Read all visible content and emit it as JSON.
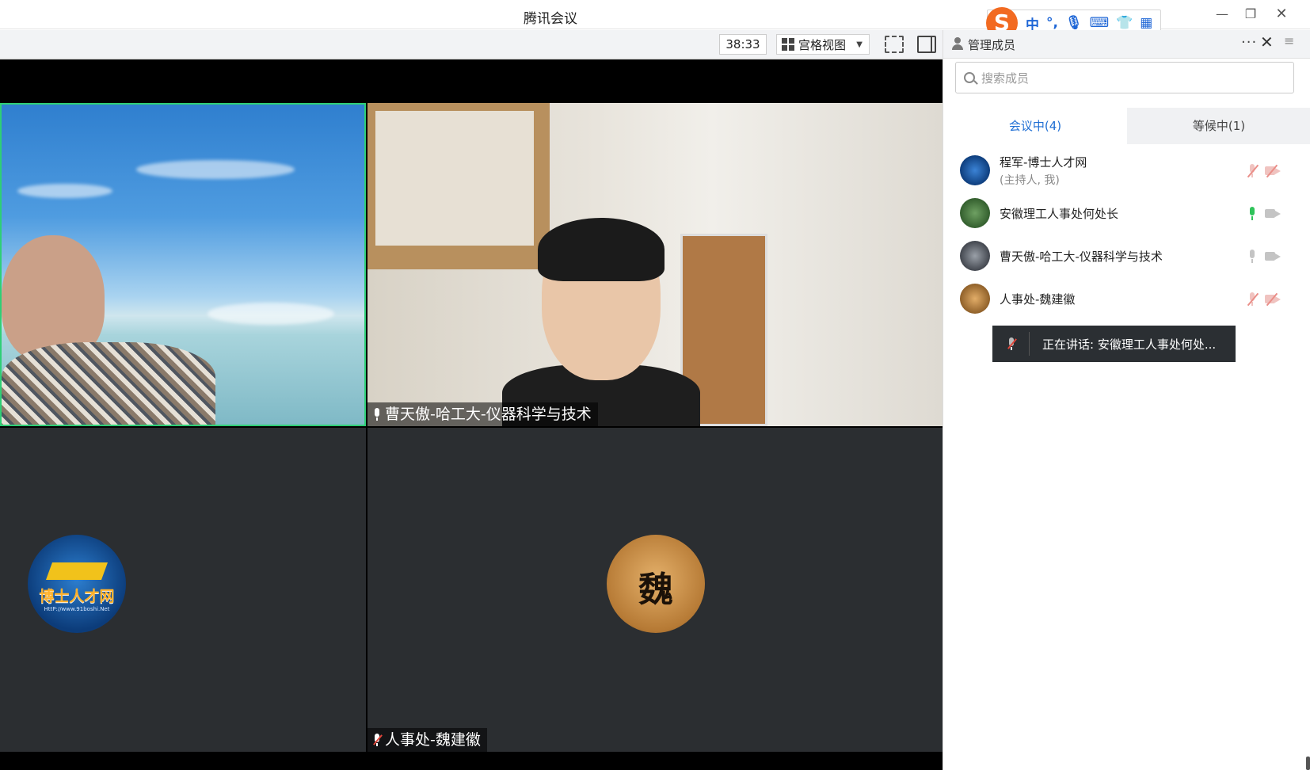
{
  "window": {
    "title": "腾讯会议",
    "minimize_icon": "minimize-icon",
    "restore_icon": "restore-icon",
    "close_icon": "close-icon"
  },
  "ime": {
    "logo": "S",
    "items": [
      "中",
      "°,",
      "mic-icon",
      "keyboard-icon",
      "shirt-icon",
      "apps-icon"
    ]
  },
  "toolbar": {
    "timer": "38:33",
    "view_label": "宫格视图"
  },
  "tiles": [
    {
      "name": "",
      "kind": "video",
      "active_speaker": true
    },
    {
      "name": "曹天傲-哈工大-仪器科学与技术",
      "kind": "video",
      "mic": "on"
    },
    {
      "name": "",
      "kind": "avatar",
      "avatar_text": "博士人才网",
      "avatar_sub": "HttP://www.91boshi.Net"
    },
    {
      "name": "人事处-魏建徽",
      "kind": "avatar",
      "avatar_text": "魏",
      "mic": "muted"
    }
  ],
  "panel": {
    "title": "管理成员",
    "search_placeholder": "搜索成员",
    "tabs": [
      {
        "label": "会议中(4)",
        "active": true
      },
      {
        "label": "等候中(1)",
        "active": false
      }
    ],
    "members": [
      {
        "name": "程军-博士人才网",
        "sub": "(主持人, 我)",
        "mic": "muted",
        "cam": "muted"
      },
      {
        "name": "安徽理工人事处何处长",
        "sub": "",
        "mic": "on",
        "cam": "off"
      },
      {
        "name": "曹天傲-哈工大-仪器科学与技术",
        "sub": "",
        "mic": "off",
        "cam": "off"
      },
      {
        "name": "人事处-魏建徽",
        "sub": "",
        "mic": "muted",
        "cam": "muted"
      }
    ],
    "speaking": "正在讲话: 安徽理工人事处何处..."
  },
  "colors": {
    "accent": "#1f6fd4",
    "active_border": "#2fcf76",
    "mic_on": "#2fc35a",
    "muted": "#e0453a"
  }
}
